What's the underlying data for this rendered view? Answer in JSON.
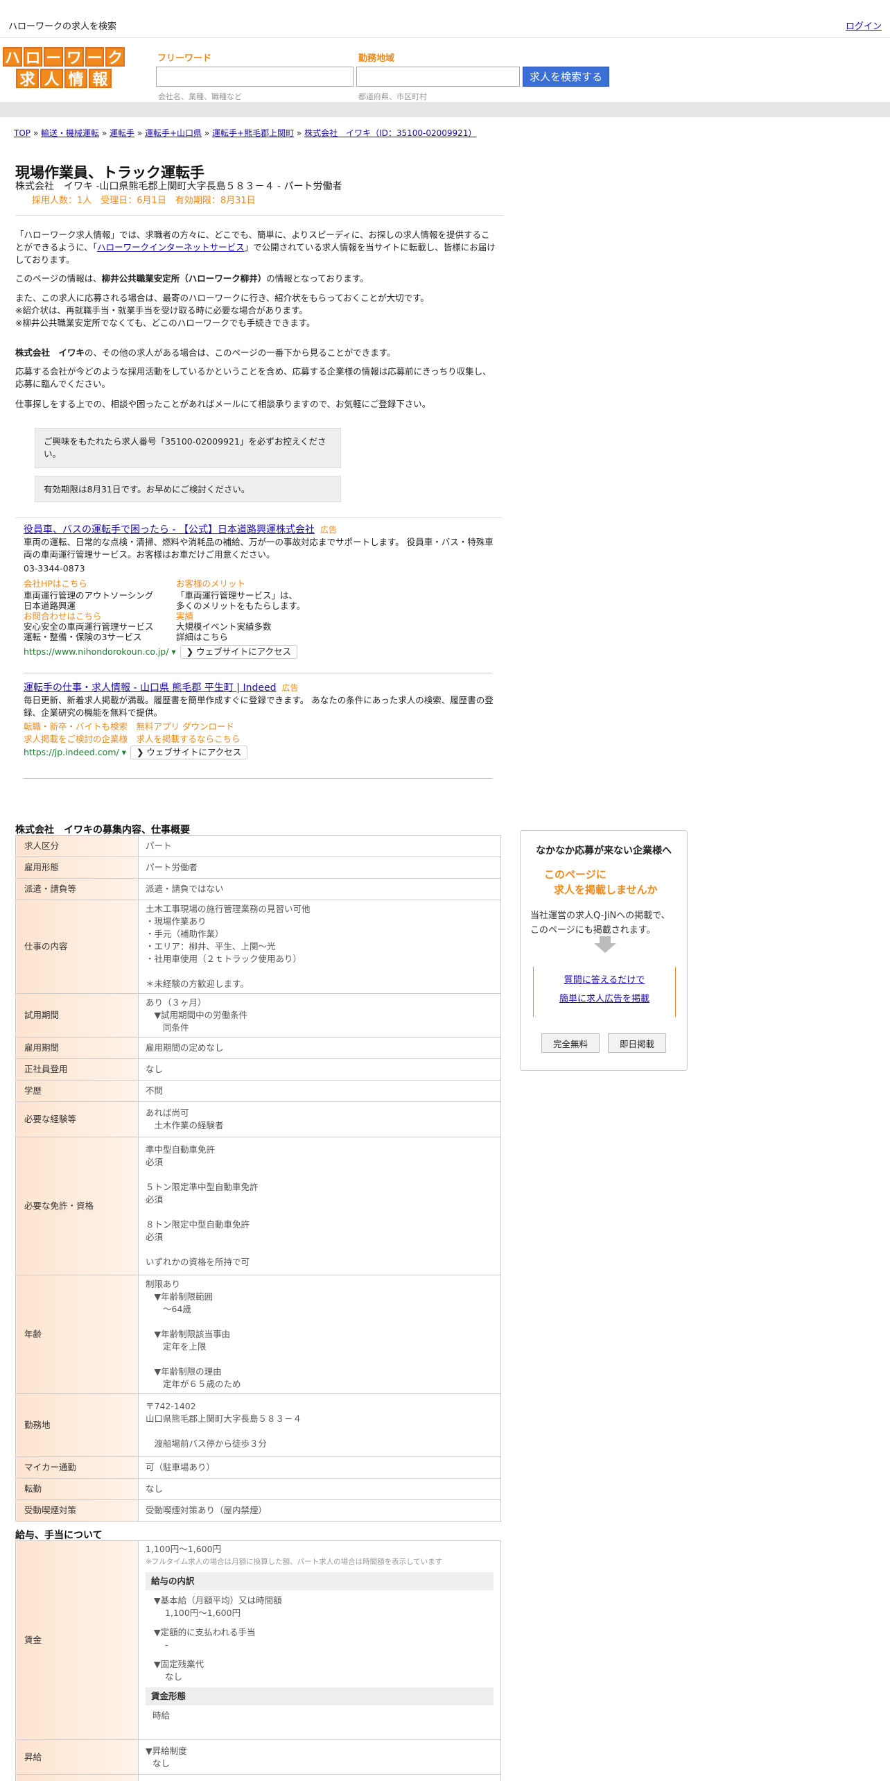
{
  "topbar": {
    "site_name": "ハローワークの求人を検索",
    "login": "ログイン"
  },
  "logo": {
    "row1": [
      "ハ",
      "ロ",
      "ー",
      "ワ",
      "ー",
      "ク"
    ],
    "row2": [
      "求",
      "人",
      "情",
      "報"
    ]
  },
  "search": {
    "freeword_label": "フリーワード",
    "freeword_hint": "会社名、業種、職種など",
    "area_label": "勤務地域",
    "area_hint": "都道府県、市区町村",
    "button": "求人を検索する"
  },
  "breadcrumb": [
    "TOP",
    "輸送・機械運転",
    "運転手",
    "運転手+山口県",
    "運転手+熊毛郡上関町",
    "株式会社　イワキ（ID：35100-02009921）"
  ],
  "job": {
    "title": "現場作業員、トラック運転手",
    "subtitle": "株式会社　イワキ -山口県熊毛郡上関町大字長島５８３－４ - パート労働者",
    "meta": "採用人数：1人　受理日：6月1日　有効期限：8月31日"
  },
  "intro": {
    "p1a": "「ハローワーク求人情報」では、求職者の方々に、どこでも、簡単に、よりスピーディに、お探しの求人情報を提供することができるように、「",
    "p1link": "ハローワークインターネットサービス",
    "p1b": "」で公開されている求人情報を当サイトに転載し、皆様にお届けしております。",
    "p2a": "このページの情報は、",
    "p2b": "柳井公共職業安定所（ハローワーク柳井）",
    "p2c": "の情報となっております。",
    "p3l1": "また、この求人に応募される場合は、最寄のハローワークに行き、紹介状をもらっておくことが大切です。",
    "p3l2": "※紹介状は、再就職手当・就業手当を受け取る時に必要な場合があります。",
    "p3l3": "※柳井公共職業安定所でなくても、どこのハローワークでも手続きできます。",
    "p4a": "株式会社　イワキ",
    "p4b": "の、その他の求人がある場合は、このページの一番下から見ることができます。",
    "p5": "応募する会社が今どのような採用活動をしているかということを含め、応募する企業様の情報は応募前にきっちり収集し、応募に臨んでください。",
    "p6": "仕事探しをする上での、相談や困ったことがあればメールにて相談承りますので、お気軽にご登録下さい。"
  },
  "notes": {
    "n1": "ご興味をもたれたら求人番号「35100-02009921」を必ずお控えください。",
    "n2": "有効期限は8月31日です。お早めにご検討ください。"
  },
  "ads": [
    {
      "title": "役員車、バスの運転手で困ったら - 【公式】日本道路興運株式会社",
      "badge": "広告",
      "desc": "車両の運転、日常的な点検・清掃、燃料や消耗品の補給、万が一の事故対応までサポートします。 役員車・バス・特殊車両の車両運行管理サービス。お客様はお車だけご用意ください。",
      "phone": "03-3344-0873",
      "links": [
        {
          "head": "会社HPはこちら",
          "l1": "車両運行管理のアウトソーシング",
          "l2": "日本道路興運"
        },
        {
          "head": "お客様のメリット",
          "l1": "「車両運行管理サービス」は、",
          "l2": "多くのメリットをもたらします。"
        },
        {
          "head": "お問合わせはこちら",
          "l1": "安心安全の車両運行管理サービス",
          "l2": "運転・整備・保険の3サービス"
        },
        {
          "head": "実績",
          "l1": "大規模イベント実績多数",
          "l2": "詳細はこちら"
        }
      ],
      "url": "https://www.nihondorokoun.co.jp/",
      "visit": "ウェブサイトにアクセス"
    },
    {
      "title": "運転手の仕事・求人情報 - 山口県 熊毛郡 平生町 | Indeed",
      "badge": "広告",
      "desc": "毎日更新、新着求人掲載が満載。履歴書を簡単作成すぐに登録できます。 あなたの条件にあった求人の検索、履歴書の登録、企業研究の機能を無料で提供。",
      "sitelinks": [
        "転職・新卒・バイトも検索",
        "無料アプリ ダウンロード",
        "求人掲載をご検討の企業様",
        "求人を掲載するならこちら"
      ],
      "url": "https://jp.indeed.com/",
      "visit": "ウェブサイトにアクセス"
    }
  ],
  "section1_title": "株式会社　イワキの募集内容、仕事概要",
  "table1": [
    {
      "label": "求人区分",
      "lines": [
        "パート"
      ]
    },
    {
      "label": "雇用形態",
      "lines": [
        "パート労働者"
      ]
    },
    {
      "label": "派遣・請負等",
      "lines": [
        "派遣・請負ではない"
      ]
    },
    {
      "label": "仕事の内容",
      "lines": [
        "土木工事現場の施行管理業務の見習い可他",
        "・現場作業あり",
        "・手元（補助作業）",
        "・エリア：柳井、平生、上関～光",
        "・社用車使用（２ｔトラック使用あり）",
        "",
        "＊未経験の方歓迎します。"
      ]
    },
    {
      "label": "試用期間",
      "lines": [
        "あり（３ヶ月）",
        "　▼試用期間中の労働条件",
        "　　同条件"
      ]
    },
    {
      "label": "雇用期間",
      "lines": [
        "雇用期間の定めなし"
      ]
    },
    {
      "label": "正社員登用",
      "lines": [
        "なし"
      ]
    },
    {
      "label": "学歴",
      "lines": [
        "不問"
      ]
    },
    {
      "label": "必要な経験等",
      "lines": [
        "あれば尚可",
        "　土木作業の経験者"
      ]
    },
    {
      "label": "必要な免許・資格",
      "lines": [
        "準中型自動車免許",
        "必須",
        "",
        "５トン限定準中型自動車免許",
        "必須",
        "",
        "８トン限定中型自動車免許",
        "必須",
        "",
        "いずれかの資格を所持で可"
      ]
    },
    {
      "label": "年齢",
      "lines": [
        "制限あり",
        "　▼年齢制限範囲",
        "　　〜64歳",
        "",
        "　▼年齢制限該当事由",
        "　　定年を上限",
        "",
        "　▼年齢制限の理由",
        "　　定年が６５歳のため"
      ]
    },
    {
      "label": "勤務地",
      "lines": [
        "〒742-1402",
        "山口県熊毛郡上関町大字長島５８３－４",
        "",
        "　渡船場前バス停から徒歩３分"
      ]
    },
    {
      "label": "マイカー通勤",
      "lines": [
        "可（駐車場あり）"
      ]
    },
    {
      "label": "転勤",
      "lines": [
        "なし"
      ]
    },
    {
      "label": "受動喫煙対策",
      "lines": [
        "受動喫煙対策あり（屋内禁煙）"
      ]
    }
  ],
  "sidebar": {
    "title": "なかなか応募が来ない企業様へ",
    "orange1": "このページに",
    "orange2": "求人を掲載しませんか",
    "text1": "当社運営の求人Q-JiNへの掲載で、",
    "text2": "このページにも掲載されます。",
    "link1": "質問に答えるだけで",
    "link2": "簡単に求人広告を掲載",
    "btn1": "完全無料",
    "btn2": "即日掲載"
  },
  "section2_title": "給与、手当について",
  "wage": {
    "label": "賃金",
    "range": "1,100円〜1,600円",
    "note": "※フルタイム求人の場合は月額に換算した額、パート求人の場合は時間額を表示しています",
    "breakdown_head": "給与の内訳",
    "b1_head": "▼基本給（月額平均）又は時間額",
    "b1_val": "1,100円〜1,600円",
    "b2_head": "▼定額的に支払われる手当",
    "b2_val": "-",
    "b3_head": "▼固定残業代",
    "b3_val": "なし",
    "form_head": "賃金形態",
    "form_val": "時給"
  },
  "raise": {
    "label": "昇給",
    "l1": "▼昇給制度",
    "l2": "なし"
  }
}
